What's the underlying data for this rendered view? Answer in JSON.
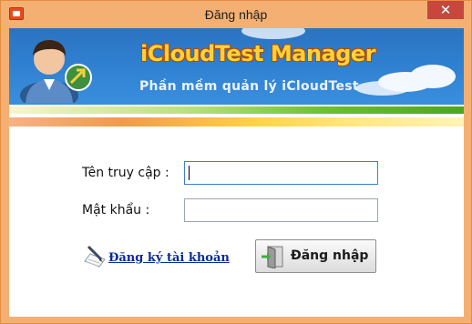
{
  "window": {
    "title": "Đăng nhập",
    "close_symbol": "✕",
    "app_icon": "app-window-icon"
  },
  "banner": {
    "title": "iCloudTest Manager",
    "subtitle": "Phần mềm quản lý iCloudTest",
    "avatar_icon": "user-avatar-icon"
  },
  "form": {
    "username_label": "Tên truy cập :",
    "username_value": "",
    "password_label": "Mật khẩu :",
    "password_value": "",
    "register_link": "Đăng ký tài khoản",
    "register_icon": "pen-paper-icon",
    "login_button": "Đăng nhập",
    "login_icon": "door-exit-icon"
  },
  "colors": {
    "window_frame": "#f4b073",
    "banner_blue": "#2f7fd0",
    "banner_title": "#ffd23a",
    "link": "#0a2a9a",
    "close_red": "#c7473c"
  }
}
